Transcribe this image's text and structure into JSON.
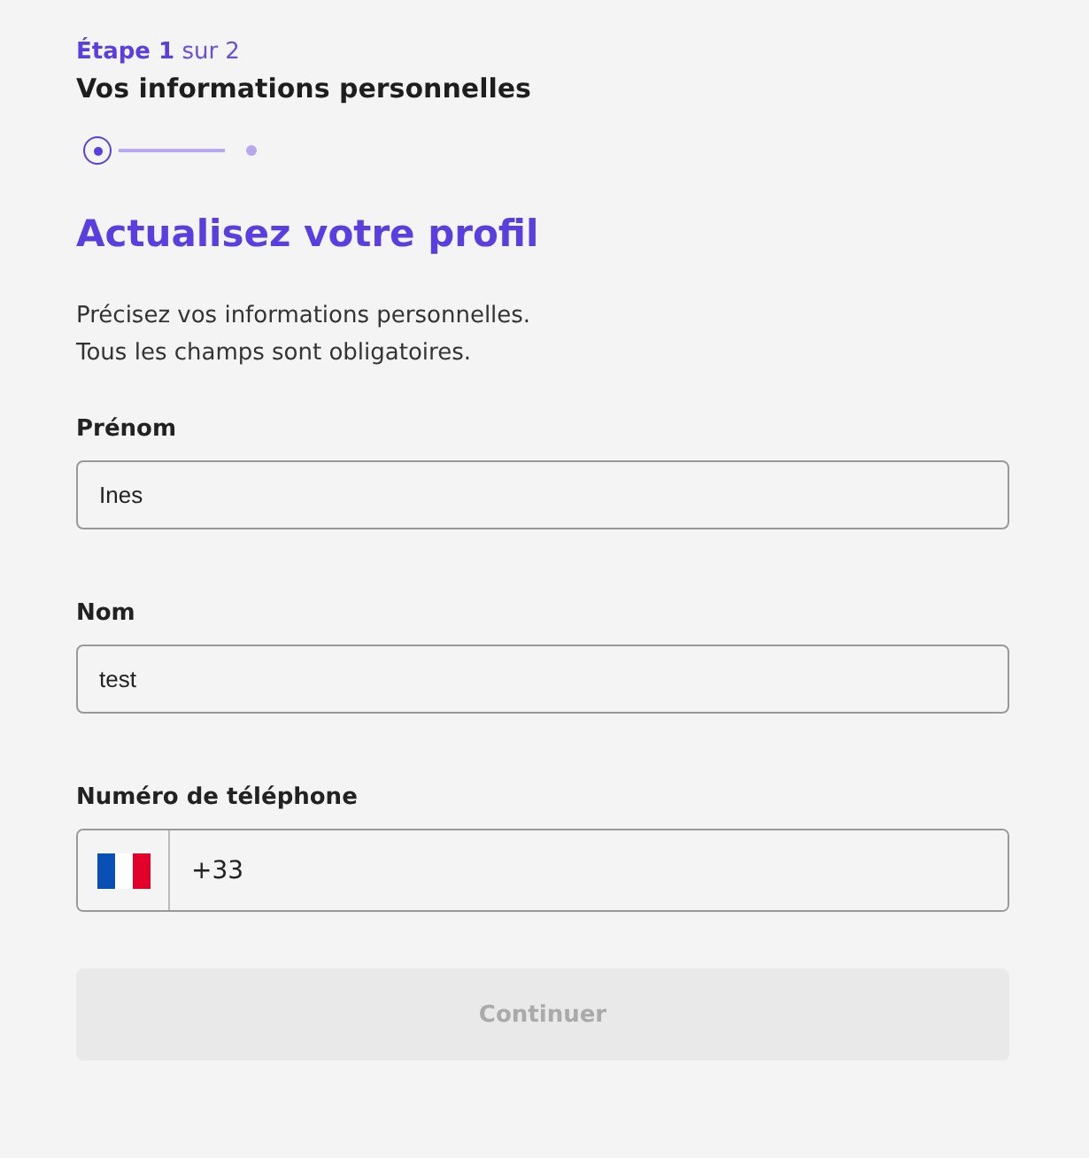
{
  "step_indicator": "**Étape 1** sur 2",
  "section_title": "Vos informations personnelles",
  "stepper": {
    "steps": [
      {
        "selected": true
      },
      {
        "selected": false
      }
    ]
  },
  "heading": "Actualisez votre profil",
  "description": [
    "Précisez vos informations personnelles.",
    "Tous les champs sont obligatoires."
  ],
  "fields": [
    {
      "kind": "text",
      "label": "Prénom",
      "value": "Ines"
    },
    {
      "kind": "text",
      "label": "Nom",
      "value": "test"
    },
    {
      "kind": "phone",
      "label": "Numéro de téléphone",
      "value": "+33"
    }
  ],
  "button": {
    "label": "Continuer",
    "disabled": true
  }
}
